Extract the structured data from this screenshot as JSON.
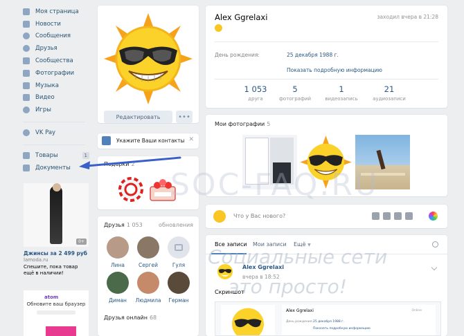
{
  "nav": {
    "items": [
      {
        "label": "Моя страница",
        "icon": "home-icon"
      },
      {
        "label": "Новости",
        "icon": "news-icon"
      },
      {
        "label": "Сообщения",
        "icon": "messages-icon"
      },
      {
        "label": "Друзья",
        "icon": "friends-icon"
      },
      {
        "label": "Сообщества",
        "icon": "communities-icon"
      },
      {
        "label": "Фотографии",
        "icon": "camera-icon"
      },
      {
        "label": "Музыка",
        "icon": "music-icon"
      },
      {
        "label": "Видео",
        "icon": "video-icon"
      },
      {
        "label": "Игры",
        "icon": "games-icon"
      }
    ],
    "vkpay": {
      "label": "VK Pay",
      "icon": "vkpay-icon"
    },
    "goods": {
      "label": "Товары",
      "icon": "bag-icon",
      "badge": "1"
    },
    "docs": {
      "label": "Документы",
      "icon": "document-icon"
    }
  },
  "ads": {
    "lamoda": {
      "badge": "0+",
      "title": "Джинсы за 2 499 руб",
      "domain": "lamoda.ru",
      "text": "Спешите, пока товар ещё в наличии!"
    },
    "atom": {
      "logo": "atom",
      "text": "Обновите ваш браузер"
    }
  },
  "avatar_card": {
    "edit_label": "Редактировать",
    "more_label": "•••"
  },
  "contact_card": {
    "label": "Укажите Ваши контакты",
    "close": "✕"
  },
  "gifts": {
    "title": "Подарки",
    "count": "2"
  },
  "friends": {
    "title": "Друзья",
    "count": "1 053",
    "updates": "обновления",
    "list": [
      {
        "name": "Лина",
        "color": "#b89a88"
      },
      {
        "name": "Сергей",
        "color": "#8a7766"
      },
      {
        "name": "Гуля",
        "color": "#e1e5eb"
      },
      {
        "name": "Диман",
        "color": "#4a6a4a"
      },
      {
        "name": "Людмила",
        "color": "#c48a6a"
      },
      {
        "name": "Герман",
        "color": "#5a4a3a"
      }
    ],
    "online_title": "Друзья онлайн",
    "online_count": "68"
  },
  "profile": {
    "name": "Alex Ggrelaxi",
    "status_emoji": "sun-emoji",
    "last_seen": "заходил вчера в 21:28",
    "birthday_label": "День рождения:",
    "birthday_value": "25 декабря 1988 г.",
    "more_info": "Показать подробную информацию",
    "stats": [
      {
        "num": "1 053",
        "label": "друга"
      },
      {
        "num": "5",
        "label": "фотографий"
      },
      {
        "num": "1",
        "label": "видеозапись"
      },
      {
        "num": "21",
        "label": "аудиозаписи"
      }
    ]
  },
  "photos": {
    "title": "Мои фотографии",
    "count": "5"
  },
  "new_post": {
    "placeholder": "Что у Вас нового?"
  },
  "wall": {
    "tabs": [
      "Все записи",
      "Мои записи",
      "Ещё"
    ],
    "post": {
      "author": "Alex Ggrelaxi",
      "date": "вчера в 18:52",
      "text": "Скриншот",
      "shot_name": "Alex Ggrelaxi",
      "shot_status": "Online",
      "shot_label": "День рождения:",
      "shot_value": "25 декабря 1988 г.",
      "shot_more": "Показать подробную информацию"
    }
  },
  "watermark": {
    "line1": "SOC-FAQ.RU",
    "line2": "Социальные сети",
    "line3": "это просто!"
  },
  "colors": {
    "accent": "#5181b8",
    "link": "#2a5885",
    "arrow": "#3b5fc9",
    "bg": "#edeef0"
  }
}
